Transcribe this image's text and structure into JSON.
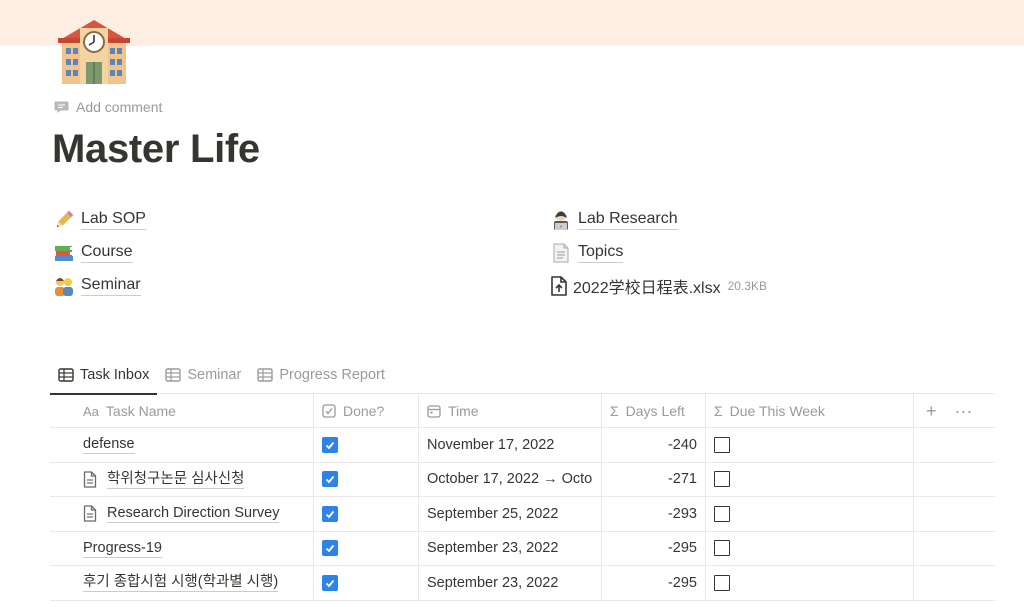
{
  "page": {
    "icon": "school-building-icon",
    "add_comment": "Add comment",
    "title": "Master Life"
  },
  "links": {
    "left": [
      {
        "emoji": "pencil-icon",
        "label": "Lab SOP"
      },
      {
        "emoji": "books-icon",
        "label": "Course"
      },
      {
        "emoji": "people-icon",
        "label": "Seminar"
      }
    ],
    "right": [
      {
        "emoji": "technologist-icon",
        "label": "Lab Research"
      },
      {
        "emoji": "page-icon",
        "label": "Topics"
      }
    ],
    "file": {
      "name": "2022学校日程表.xlsx",
      "size": "20.3KB"
    }
  },
  "tabs": [
    "Task Inbox",
    "Seminar",
    "Progress Report"
  ],
  "table": {
    "headers": {
      "name_prefix": "Aa",
      "name": "Task Name",
      "done": "Done?",
      "time": "Time",
      "days_prefix": "Σ",
      "days": "Days Left",
      "week_prefix": "Σ",
      "week": "Due This Week",
      "add": "+",
      "more": "···"
    },
    "rows": [
      {
        "name": "defense",
        "doc": false,
        "done": true,
        "time": "November 17, 2022",
        "days": "-240",
        "due_this_week": false
      },
      {
        "name": "학위청구논문 심사신청",
        "doc": true,
        "done": true,
        "time": "October 17, 2022 → Octo",
        "days": "-271",
        "due_this_week": false
      },
      {
        "name": "Research Direction Survey",
        "doc": true,
        "done": true,
        "time": "September 25, 2022",
        "days": "-293",
        "due_this_week": false
      },
      {
        "name": "Progress-19",
        "doc": false,
        "done": true,
        "time": "September 23, 2022",
        "days": "-295",
        "due_this_week": false
      },
      {
        "name": "후기 종합시험 시행(학과별 시행)",
        "doc": false,
        "done": true,
        "time": "September 23, 2022",
        "days": "-295",
        "due_this_week": false
      }
    ]
  },
  "colors": {
    "cover": "#fdeee3",
    "text": "#37352f",
    "muted": "#9b9a97",
    "checkbox": "#2e83e8"
  }
}
